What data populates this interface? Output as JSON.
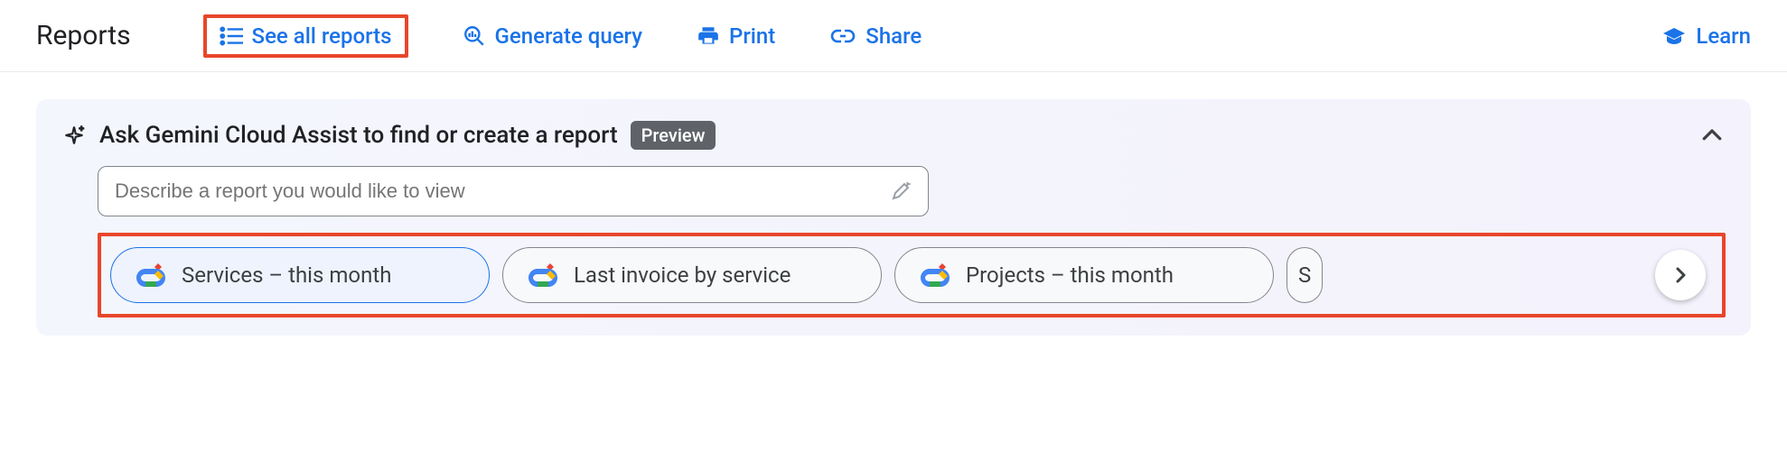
{
  "header": {
    "title": "Reports",
    "actions": {
      "see_all": "See all reports",
      "generate_query": "Generate query",
      "print": "Print",
      "share": "Share",
      "learn": "Learn"
    }
  },
  "panel": {
    "title": "Ask Gemini Cloud Assist to find or create a report",
    "badge": "Preview",
    "input_placeholder": "Describe a report you would like to view",
    "chips": [
      {
        "label": "Services – this month",
        "selected": true
      },
      {
        "label": "Last invoice by service",
        "selected": false
      },
      {
        "label": "Projects – this month",
        "selected": false
      }
    ],
    "partial_chip": "S"
  }
}
